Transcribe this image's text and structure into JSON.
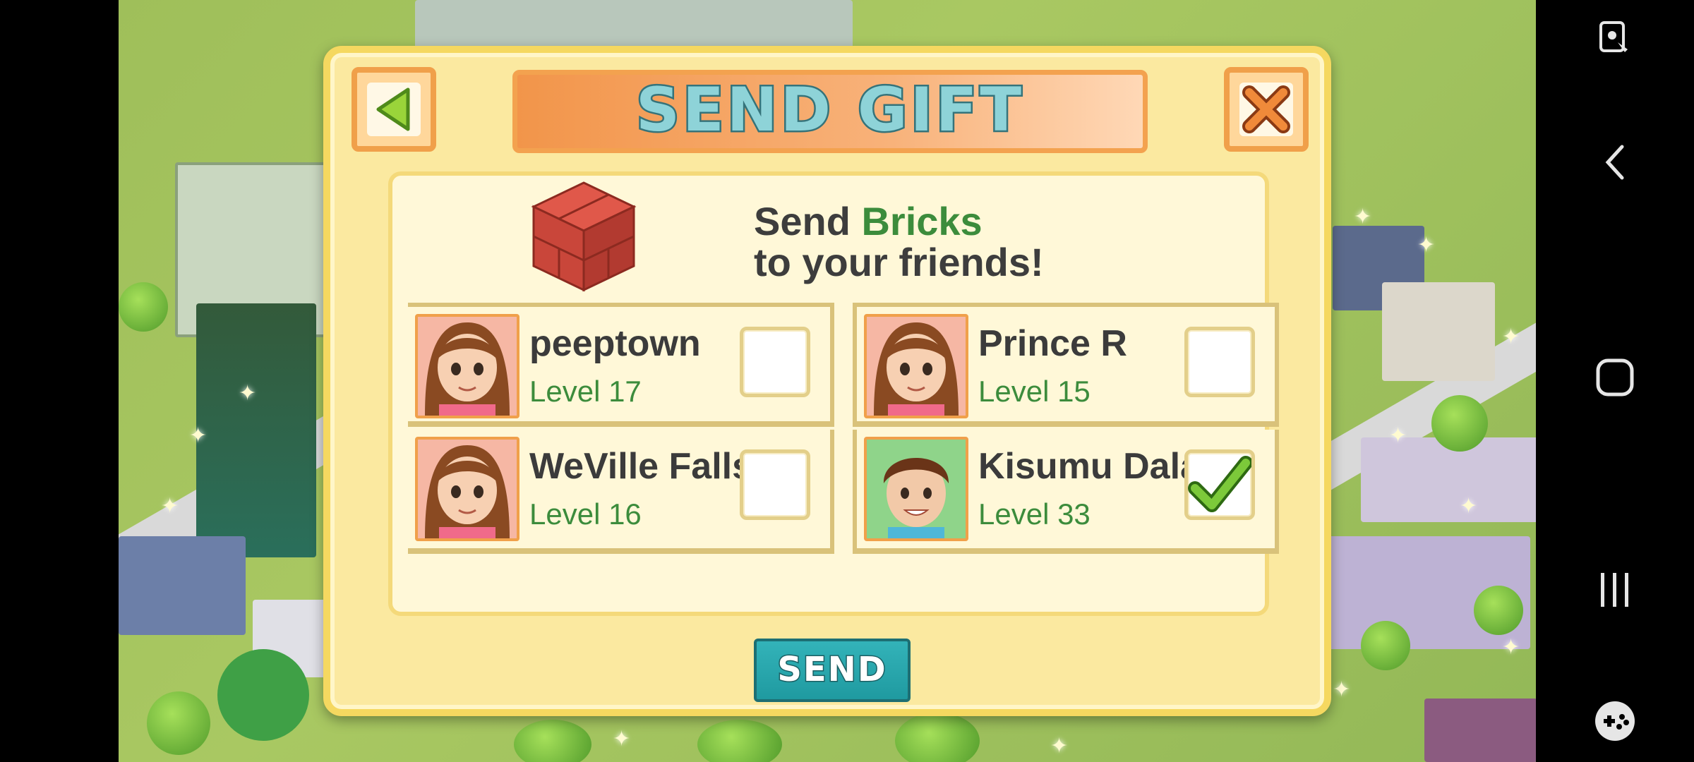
{
  "dialog": {
    "title": "SEND GIFT",
    "headline_prefix": "Send ",
    "headline_item": "Bricks",
    "headline_suffix": "to your friends!",
    "send_label": "SEND"
  },
  "friends": [
    {
      "name": "peeptown",
      "level": "Level 17",
      "checked": false,
      "avatar": "girl"
    },
    {
      "name": "Prince R",
      "level": "Level 15",
      "checked": false,
      "avatar": "girl"
    },
    {
      "name": "WeVille Falls",
      "level": "Level 16",
      "checked": false,
      "avatar": "girl"
    },
    {
      "name": "Kisumu Dala",
      "level": "Level 33",
      "checked": true,
      "avatar": "boy"
    }
  ],
  "icons": {
    "back": "left-arrow-icon",
    "close": "close-x-icon",
    "gift": "brick-stack-icon",
    "nav": [
      "screen-lock-icon",
      "back-chevron-icon",
      "home-square-icon",
      "recents-icon",
      "game-launcher-icon"
    ]
  },
  "colors": {
    "panel": "#fbe9a0",
    "title_orange": "#f2954a",
    "send_teal": "#26a8ae",
    "level_green": "#3c8c3c"
  }
}
